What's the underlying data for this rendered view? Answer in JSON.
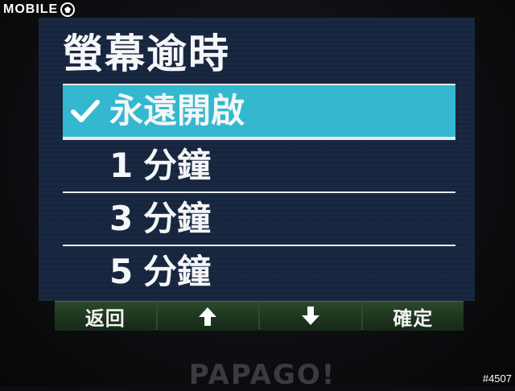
{
  "watermark": {
    "brand": "MOBILE",
    "icon": "fist-icon",
    "id": "#4507"
  },
  "screen": {
    "title": "螢幕逾時",
    "items": [
      {
        "num": "",
        "label": "永遠開啟",
        "selected": true
      },
      {
        "num": "1",
        "label": "分鐘",
        "selected": false
      },
      {
        "num": "3",
        "label": "分鐘",
        "selected": false
      },
      {
        "num": "5",
        "label": "分鐘",
        "selected": false
      }
    ]
  },
  "toolbar": {
    "back": "返回",
    "up_icon": "arrow-up-icon",
    "down_icon": "arrow-down-icon",
    "confirm": "確定"
  },
  "device": {
    "brand": "PAPAGO!"
  },
  "colors": {
    "highlight": "#33b8cf",
    "screen_bg": "#1b2a44",
    "toolbar_bg": "#1e351f"
  }
}
